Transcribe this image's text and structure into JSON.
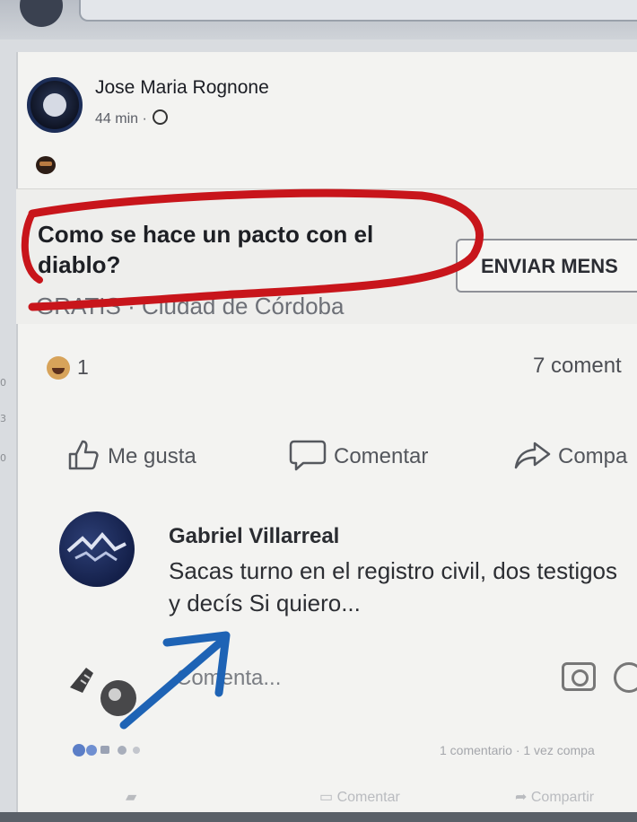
{
  "post": {
    "author": "Jose Maria Rognone",
    "time": "44 min ·",
    "question": "Como se hace un pacto con el diablo?",
    "send_button": "ENVIAR MENS",
    "location": "GRATIS · Ciudad de Córdoba",
    "reaction_count": "1",
    "comments_count": "7 coment"
  },
  "actions": {
    "like": "Me gusta",
    "comment": "Comentar",
    "share": "Compa"
  },
  "comment": {
    "author": "Gabriel Villarreal",
    "text": "Sacas turno en el registro civil, dos testigos y decís Si quiero..."
  },
  "comment_box": {
    "placeholder": "Comenta..."
  },
  "footer": {
    "meta": "1 comentario · 1 vez compa",
    "comentar": "Comentar",
    "compartir": "Compartir"
  },
  "side_numbers": [
    "0",
    "3",
    "0"
  ],
  "colors": {
    "annotation_red": "#c8151b",
    "arrow_blue": "#1e63b5"
  }
}
